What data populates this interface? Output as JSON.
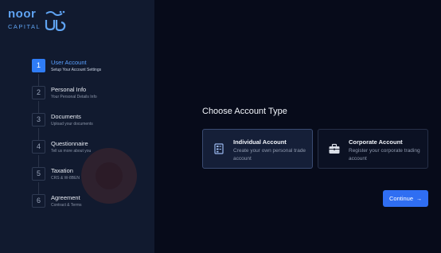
{
  "brand": {
    "logo_word": "noor",
    "logo_sub": "CAPITAL",
    "logo_arabic": "كابيتال نور",
    "color": "#5fa3f2"
  },
  "steps": [
    {
      "num": "1",
      "title": "User Account",
      "subtitle": "Setup Your Account Settings",
      "active": true
    },
    {
      "num": "2",
      "title": "Personal Info",
      "subtitle": "Your Personal Details Info",
      "active": false
    },
    {
      "num": "3",
      "title": "Documents",
      "subtitle": "Upload your documents",
      "active": false
    },
    {
      "num": "4",
      "title": "Questionnaire",
      "subtitle": "Tell us more about you",
      "active": false
    },
    {
      "num": "5",
      "title": "Taxation",
      "subtitle": "CRS & W-8BEN",
      "active": false
    },
    {
      "num": "6",
      "title": "Agreement",
      "subtitle": "Contract & Terms",
      "active": false
    }
  ],
  "main": {
    "title": "Choose Account Type",
    "cards": [
      {
        "title": "Individual Account",
        "description": "Create your own personal trade account",
        "icon": "id-card-icon",
        "selected": true
      },
      {
        "title": "Corporate Account",
        "description": "Register your corporate trading account",
        "icon": "briefcase-icon",
        "selected": false
      }
    ],
    "continue_label": "Continue",
    "continue_arrow": "→"
  },
  "colors": {
    "accent": "#2f7cf6",
    "background": "#070b1a",
    "sidebar": "#111a2f"
  }
}
